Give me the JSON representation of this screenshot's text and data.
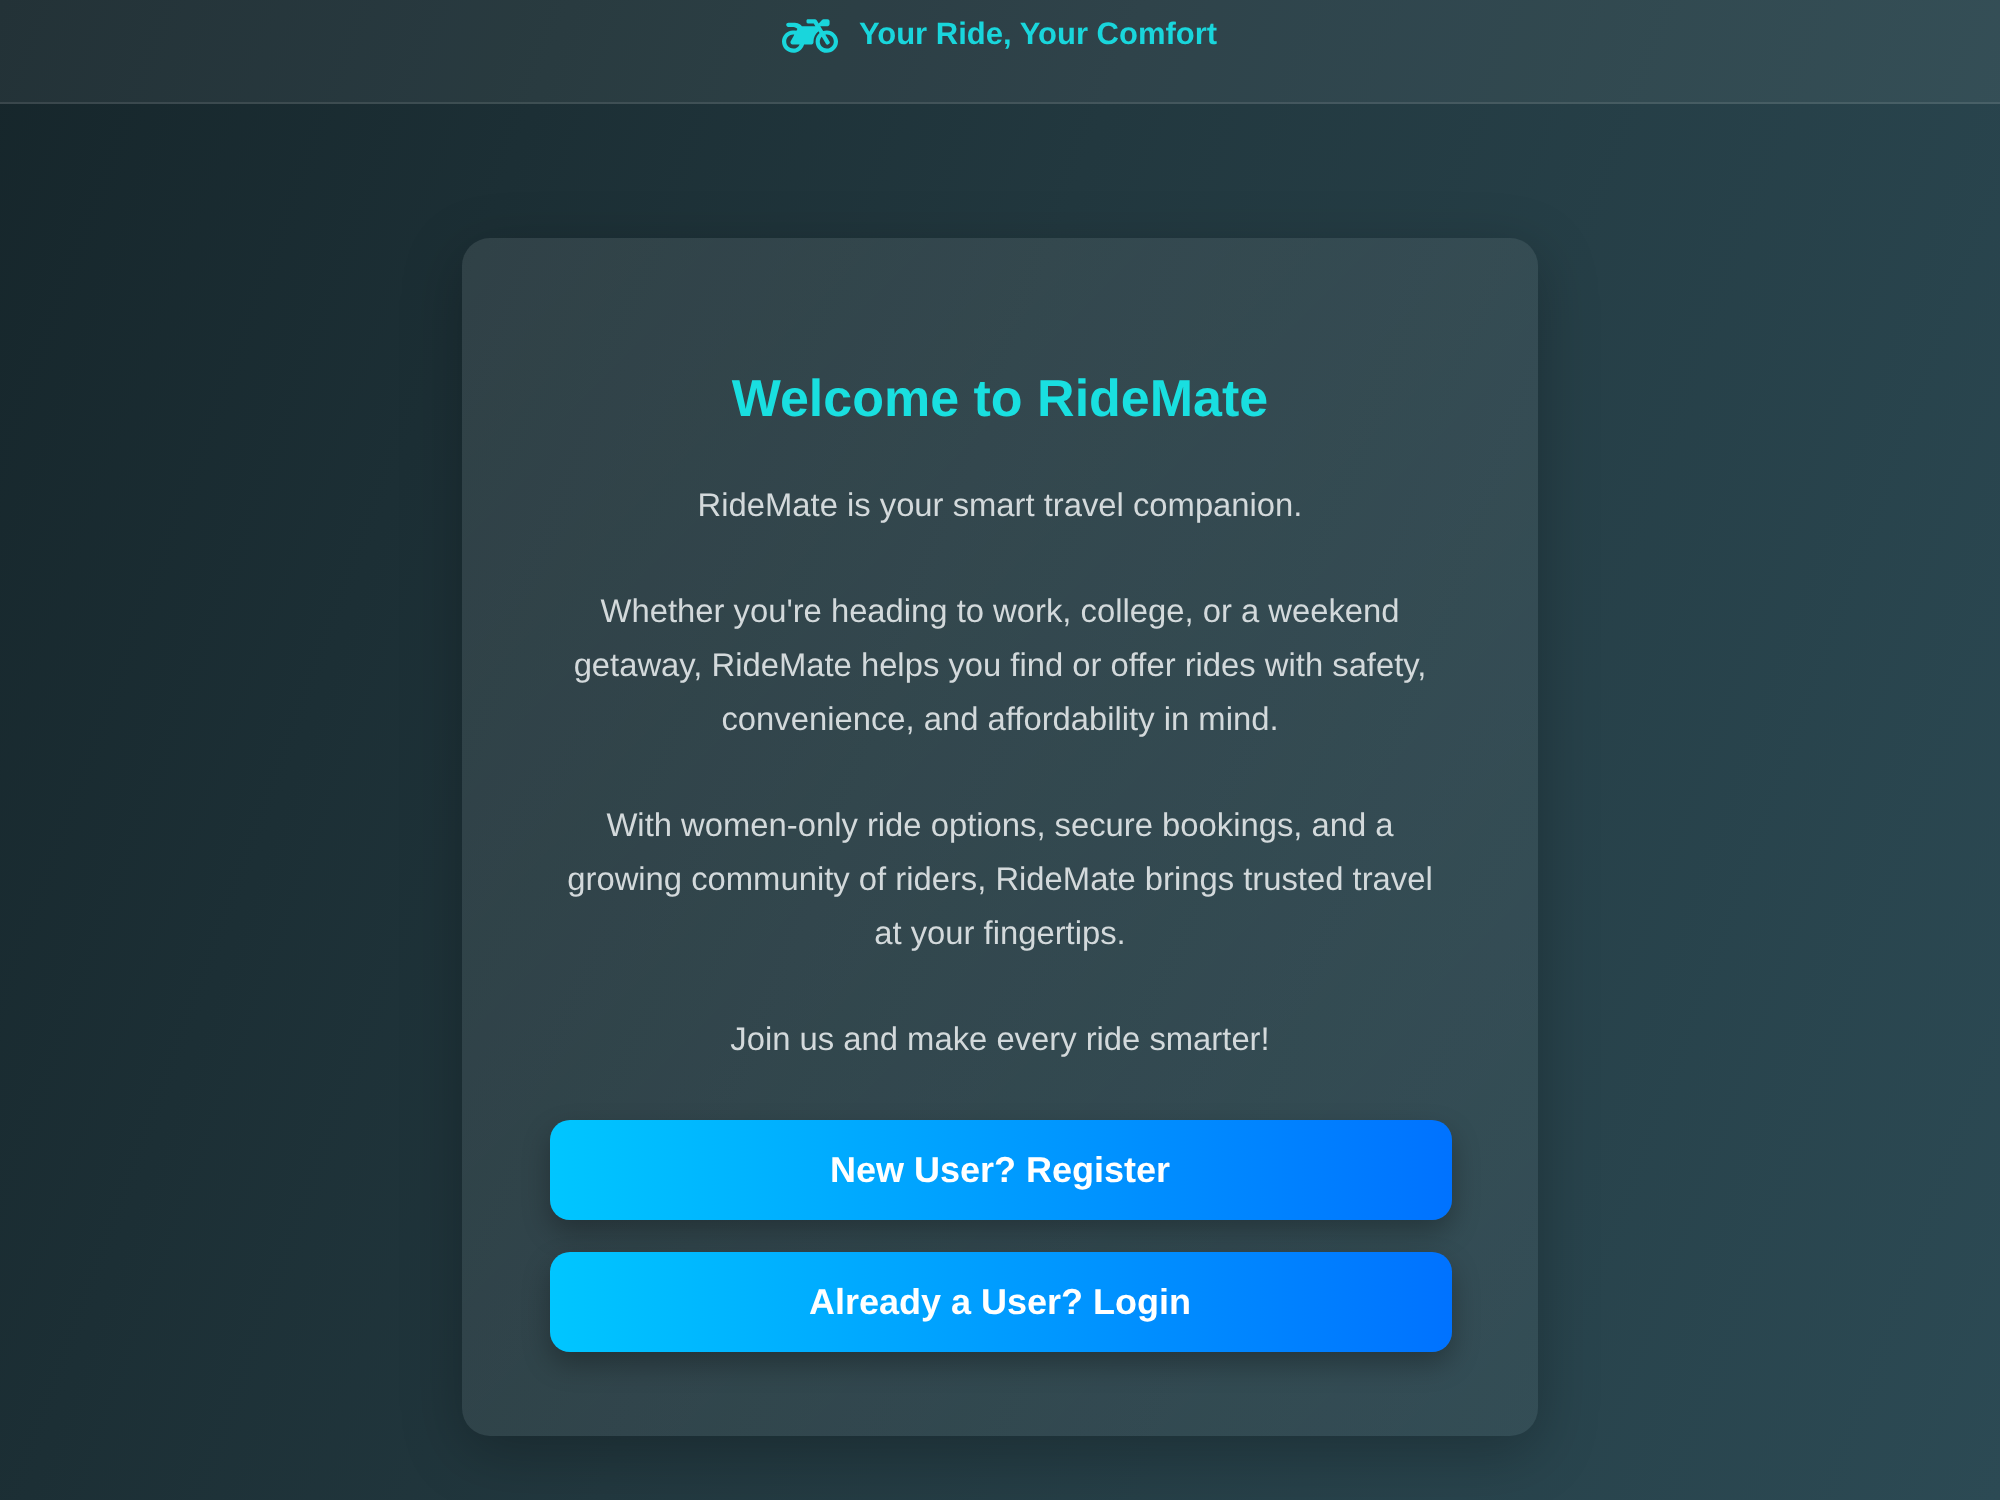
{
  "header": {
    "tagline": "Your Ride, Your Comfort"
  },
  "welcome_card": {
    "title": "Welcome to RideMate",
    "paragraphs": [
      "RideMate is your smart travel companion.",
      "Whether you're heading to work, college, or a weekend getaway, RideMate helps you find or offer rides with safety, convenience, and affordability in mind.",
      "With women-only ride options, secure bookings, and a growing community of riders, RideMate brings trusted travel at your fingertips.",
      "Join us and make every ride smarter!"
    ],
    "buttons": [
      {
        "label": "New User? Register"
      },
      {
        "label": "Already a User? Login"
      }
    ]
  }
}
